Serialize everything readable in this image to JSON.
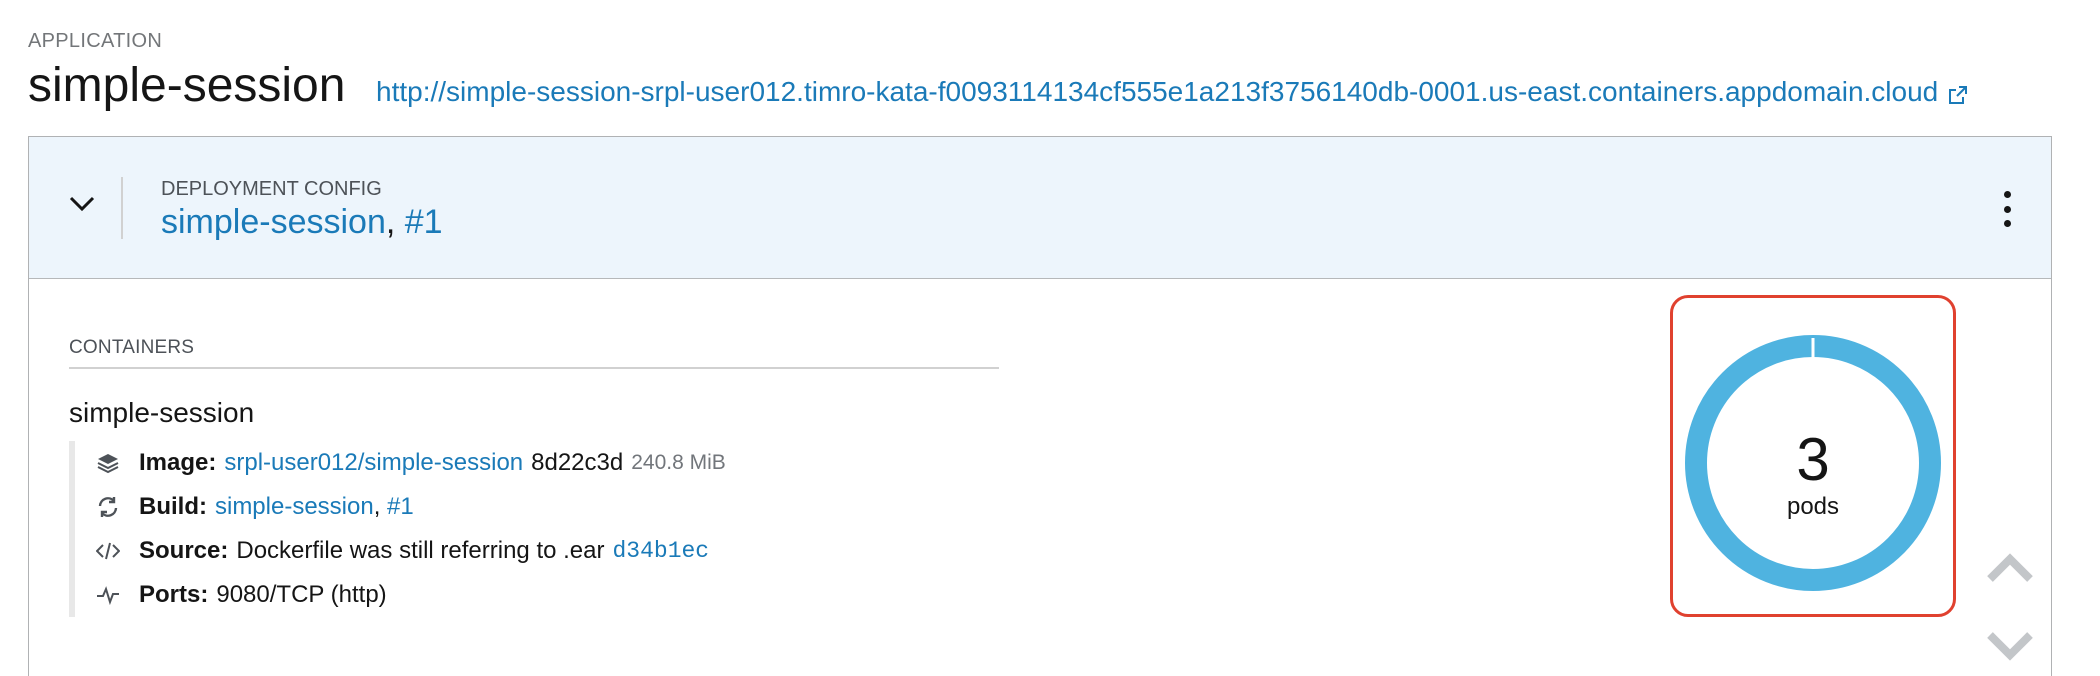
{
  "application": {
    "kicker": "APPLICATION",
    "name": "simple-session",
    "route_url": "http://simple-session-srpl-user012.timro-kata-f0093114134cf555e1a213f3756140db-0001.us-east.containers.appdomain.cloud",
    "route_icon": "external-link-icon"
  },
  "deployment": {
    "kicker": "DEPLOYMENT CONFIG",
    "name": "simple-session",
    "separator": ",",
    "revision": "#1",
    "toggle_icon": "chevron-down-icon",
    "actions_icon": "kebab-menu-icon"
  },
  "containers": {
    "heading": "CONTAINERS",
    "name": "simple-session",
    "image": {
      "label": "Image:",
      "repo": "srpl-user012/simple-session",
      "digest": "8d22c3d",
      "size": "240.8 MiB",
      "icon": "layers-icon"
    },
    "build": {
      "label": "Build:",
      "name": "simple-session",
      "separator": ",",
      "number": "#1",
      "icon": "refresh-icon"
    },
    "source": {
      "label": "Source:",
      "message": "Dockerfile was still referring to .ear",
      "commit": "d34b1ec",
      "icon": "code-icon"
    },
    "ports": {
      "label": "Ports:",
      "value": "9080/TCP (http)",
      "icon": "pulse-icon"
    }
  },
  "pods": {
    "count": "3",
    "unit": "pods",
    "ring_color": "#4fb3e0",
    "highlight_color": "#e0412f",
    "scale_up_icon": "chevron-up-icon",
    "scale_down_icon": "chevron-down-icon"
  },
  "colors": {
    "link": "#1a7ab8",
    "header_bg": "#edf5fc"
  }
}
